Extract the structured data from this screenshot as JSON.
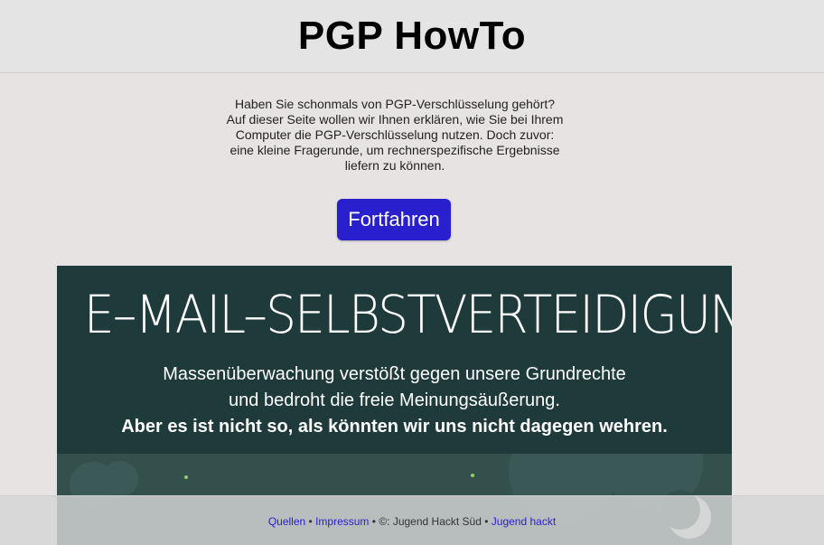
{
  "header": {
    "title": "PGP HowTo"
  },
  "intro": {
    "lines": [
      "Haben Sie schonmals von PGP-Verschlüsselung gehört?",
      "Auf dieser Seite wollen wir Ihnen erklären, wie Sie bei Ihrem",
      "Computer die PGP-Verschlüsselung nutzen. Doch zuvor:",
      "eine kleine Fragerunde, um rechnerspezifische Ergebnisse",
      "liefern zu können."
    ]
  },
  "actions": {
    "continue_label": "Fortfahren"
  },
  "banner": {
    "title": "E–MAIL–SELBSTVERTEIDIGUNG",
    "line1": "Massenüberwachung verstößt gegen unsere Grundrechte",
    "line2": "und bedroht die freie Meinungsäußerung.",
    "line3": "Aber es ist nicht so, als könnten wir uns nicht dagegen wehren."
  },
  "footer": {
    "links": {
      "sources": "Quellen",
      "imprint": "Impressum",
      "jugend_hackt": "Jugend hackt"
    },
    "separator": "•",
    "copyright": "©: Jugend Hackt Süd"
  },
  "colors": {
    "accent": "#2a1fcc",
    "banner_bg": "#1f3a3a",
    "page_bg": "#e8e3e3"
  }
}
